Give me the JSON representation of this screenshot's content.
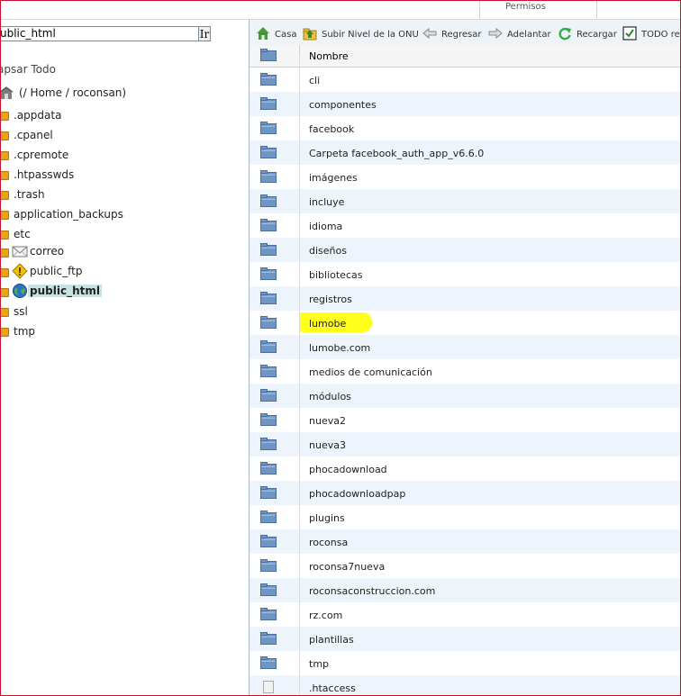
{
  "header": {
    "permissions_col": "Permisos"
  },
  "left_panel": {
    "path_input_value": "ublic_html",
    "go_button": "Ir",
    "collapse_all": "apsar Todo",
    "home_label": "(/ Home / roconsan)",
    "tree": [
      {
        "label": ".appdata",
        "type": "folder"
      },
      {
        "label": ".cpanel",
        "type": "folder"
      },
      {
        "label": ".cpremote",
        "type": "folder"
      },
      {
        "label": ".htpasswds",
        "type": "folder"
      },
      {
        "label": ".trash",
        "type": "folder"
      },
      {
        "label": "application_backups",
        "type": "folder"
      },
      {
        "label": "etc",
        "type": "folder"
      },
      {
        "label": "correo",
        "type": "mail"
      },
      {
        "label": "public_ftp",
        "type": "ftp"
      },
      {
        "label": "public_html",
        "type": "web",
        "selected": true
      },
      {
        "label": "ssl",
        "type": "folder"
      },
      {
        "label": "tmp",
        "type": "folder"
      }
    ]
  },
  "toolbar": {
    "items": [
      {
        "label": "Casa",
        "icon": "home-icon"
      },
      {
        "label": "Subir Nivel de la ONU",
        "icon": "up-level-icon"
      },
      {
        "label": "Regresar",
        "icon": "back-arrow-icon"
      },
      {
        "label": "Adelantar",
        "icon": "forward-arrow-icon"
      },
      {
        "label": "Recargar",
        "icon": "reload-icon"
      },
      {
        "label": "TODO rec",
        "icon": "checkbox-icon"
      }
    ]
  },
  "file_list": {
    "column_name": "Nombre",
    "rows": [
      "cli",
      "componentes",
      "facebook",
      "Carpeta facebook_auth_app_v6.6.0",
      "imágenes",
      "incluye",
      "idioma",
      "diseños",
      "bibliotecas",
      "registros",
      "lumobe",
      "lumobe.com",
      "medios de comunicación",
      "módulos",
      "nueva2",
      "nueva3",
      "phocadownload",
      "phocadownloadpap",
      "plugins",
      "roconsa",
      "roconsa7nueva",
      "roconsaconstruccion.com",
      "rz.com",
      "plantillas",
      "tmp"
    ],
    "last_row_partial": ".htaccess",
    "highlighted_row": "lumobe",
    "highlight_color": "#ffff1a"
  },
  "colors": {
    "border_accent": "#c8102e",
    "alt_row": "#eef4fb",
    "selected_tree": "#c9e3e3",
    "folder_blue": "#5b86b8"
  }
}
